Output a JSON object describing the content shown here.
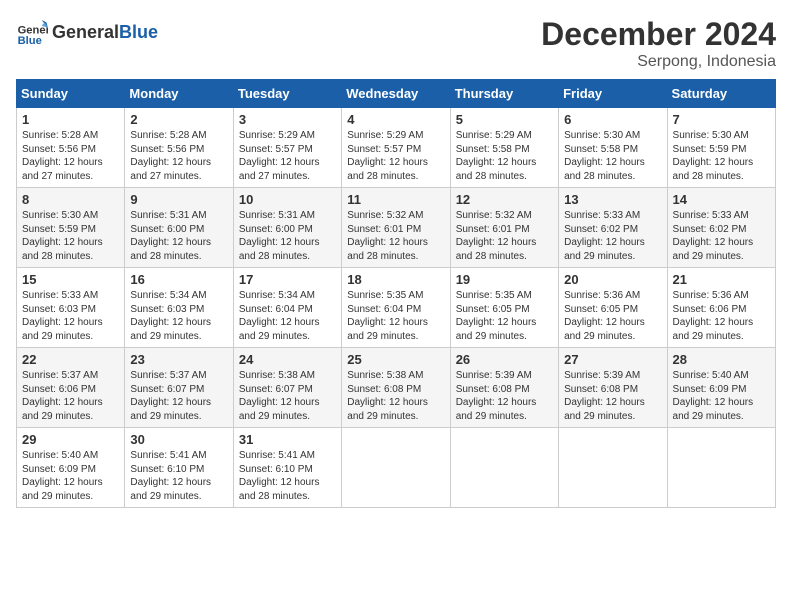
{
  "header": {
    "logo_general": "General",
    "logo_blue": "Blue",
    "month_title": "December 2024",
    "location": "Serpong, Indonesia"
  },
  "days_of_week": [
    "Sunday",
    "Monday",
    "Tuesday",
    "Wednesday",
    "Thursday",
    "Friday",
    "Saturday"
  ],
  "weeks": [
    [
      {
        "day": "1",
        "sunrise": "5:28 AM",
        "sunset": "5:56 PM",
        "daylight": "12 hours and 27 minutes."
      },
      {
        "day": "2",
        "sunrise": "5:28 AM",
        "sunset": "5:56 PM",
        "daylight": "12 hours and 27 minutes."
      },
      {
        "day": "3",
        "sunrise": "5:29 AM",
        "sunset": "5:57 PM",
        "daylight": "12 hours and 27 minutes."
      },
      {
        "day": "4",
        "sunrise": "5:29 AM",
        "sunset": "5:57 PM",
        "daylight": "12 hours and 28 minutes."
      },
      {
        "day": "5",
        "sunrise": "5:29 AM",
        "sunset": "5:58 PM",
        "daylight": "12 hours and 28 minutes."
      },
      {
        "day": "6",
        "sunrise": "5:30 AM",
        "sunset": "5:58 PM",
        "daylight": "12 hours and 28 minutes."
      },
      {
        "day": "7",
        "sunrise": "5:30 AM",
        "sunset": "5:59 PM",
        "daylight": "12 hours and 28 minutes."
      }
    ],
    [
      {
        "day": "8",
        "sunrise": "5:30 AM",
        "sunset": "5:59 PM",
        "daylight": "12 hours and 28 minutes."
      },
      {
        "day": "9",
        "sunrise": "5:31 AM",
        "sunset": "6:00 PM",
        "daylight": "12 hours and 28 minutes."
      },
      {
        "day": "10",
        "sunrise": "5:31 AM",
        "sunset": "6:00 PM",
        "daylight": "12 hours and 28 minutes."
      },
      {
        "day": "11",
        "sunrise": "5:32 AM",
        "sunset": "6:01 PM",
        "daylight": "12 hours and 28 minutes."
      },
      {
        "day": "12",
        "sunrise": "5:32 AM",
        "sunset": "6:01 PM",
        "daylight": "12 hours and 28 minutes."
      },
      {
        "day": "13",
        "sunrise": "5:33 AM",
        "sunset": "6:02 PM",
        "daylight": "12 hours and 29 minutes."
      },
      {
        "day": "14",
        "sunrise": "5:33 AM",
        "sunset": "6:02 PM",
        "daylight": "12 hours and 29 minutes."
      }
    ],
    [
      {
        "day": "15",
        "sunrise": "5:33 AM",
        "sunset": "6:03 PM",
        "daylight": "12 hours and 29 minutes."
      },
      {
        "day": "16",
        "sunrise": "5:34 AM",
        "sunset": "6:03 PM",
        "daylight": "12 hours and 29 minutes."
      },
      {
        "day": "17",
        "sunrise": "5:34 AM",
        "sunset": "6:04 PM",
        "daylight": "12 hours and 29 minutes."
      },
      {
        "day": "18",
        "sunrise": "5:35 AM",
        "sunset": "6:04 PM",
        "daylight": "12 hours and 29 minutes."
      },
      {
        "day": "19",
        "sunrise": "5:35 AM",
        "sunset": "6:05 PM",
        "daylight": "12 hours and 29 minutes."
      },
      {
        "day": "20",
        "sunrise": "5:36 AM",
        "sunset": "6:05 PM",
        "daylight": "12 hours and 29 minutes."
      },
      {
        "day": "21",
        "sunrise": "5:36 AM",
        "sunset": "6:06 PM",
        "daylight": "12 hours and 29 minutes."
      }
    ],
    [
      {
        "day": "22",
        "sunrise": "5:37 AM",
        "sunset": "6:06 PM",
        "daylight": "12 hours and 29 minutes."
      },
      {
        "day": "23",
        "sunrise": "5:37 AM",
        "sunset": "6:07 PM",
        "daylight": "12 hours and 29 minutes."
      },
      {
        "day": "24",
        "sunrise": "5:38 AM",
        "sunset": "6:07 PM",
        "daylight": "12 hours and 29 minutes."
      },
      {
        "day": "25",
        "sunrise": "5:38 AM",
        "sunset": "6:08 PM",
        "daylight": "12 hours and 29 minutes."
      },
      {
        "day": "26",
        "sunrise": "5:39 AM",
        "sunset": "6:08 PM",
        "daylight": "12 hours and 29 minutes."
      },
      {
        "day": "27",
        "sunrise": "5:39 AM",
        "sunset": "6:08 PM",
        "daylight": "12 hours and 29 minutes."
      },
      {
        "day": "28",
        "sunrise": "5:40 AM",
        "sunset": "6:09 PM",
        "daylight": "12 hours and 29 minutes."
      }
    ],
    [
      {
        "day": "29",
        "sunrise": "5:40 AM",
        "sunset": "6:09 PM",
        "daylight": "12 hours and 29 minutes."
      },
      {
        "day": "30",
        "sunrise": "5:41 AM",
        "sunset": "6:10 PM",
        "daylight": "12 hours and 29 minutes."
      },
      {
        "day": "31",
        "sunrise": "5:41 AM",
        "sunset": "6:10 PM",
        "daylight": "12 hours and 28 minutes."
      },
      null,
      null,
      null,
      null
    ]
  ],
  "labels": {
    "sunrise_prefix": "Sunrise: ",
    "sunset_prefix": "Sunset: ",
    "daylight_prefix": "Daylight: "
  }
}
